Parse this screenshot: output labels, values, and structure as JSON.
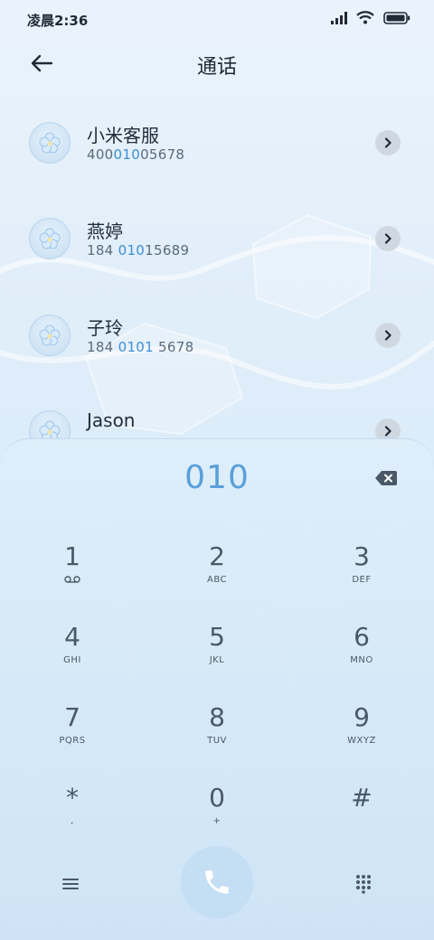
{
  "status_bar": {
    "time": "凌晨2:36",
    "icons": [
      "signal-icon",
      "wifi-icon",
      "battery-icon"
    ]
  },
  "header": {
    "title": "通话",
    "back_icon": "back-arrow-icon"
  },
  "contacts": [
    {
      "name": "小米客服",
      "number_pre": "400",
      "number_match": "010",
      "number_post": "05678"
    },
    {
      "name": "燕婷",
      "number_pre": "184 ",
      "number_match": "010",
      "number_post": "15689"
    },
    {
      "name": "子玲",
      "number_pre": "184 ",
      "number_match": "0101",
      "number_post": " 5678"
    },
    {
      "name": "Jason",
      "number_pre": "",
      "number_match": "",
      "number_post": ""
    }
  ],
  "dialer": {
    "value": "010",
    "keys": [
      {
        "digit": "1",
        "letters": ""
      },
      {
        "digit": "2",
        "letters": "ABC"
      },
      {
        "digit": "3",
        "letters": "DEF"
      },
      {
        "digit": "4",
        "letters": "GHI"
      },
      {
        "digit": "5",
        "letters": "JKL"
      },
      {
        "digit": "6",
        "letters": "MNO"
      },
      {
        "digit": "7",
        "letters": "PQRS"
      },
      {
        "digit": "8",
        "letters": "TUV"
      },
      {
        "digit": "9",
        "letters": "WXYZ"
      },
      {
        "digit": "*",
        "letters": ","
      },
      {
        "digit": "0",
        "letters": "+"
      },
      {
        "digit": "#",
        "letters": ""
      }
    ]
  },
  "colors": {
    "accent": "#5a9fd9",
    "match_highlight": "#3d8ed6",
    "call_button": "#c4def4"
  }
}
